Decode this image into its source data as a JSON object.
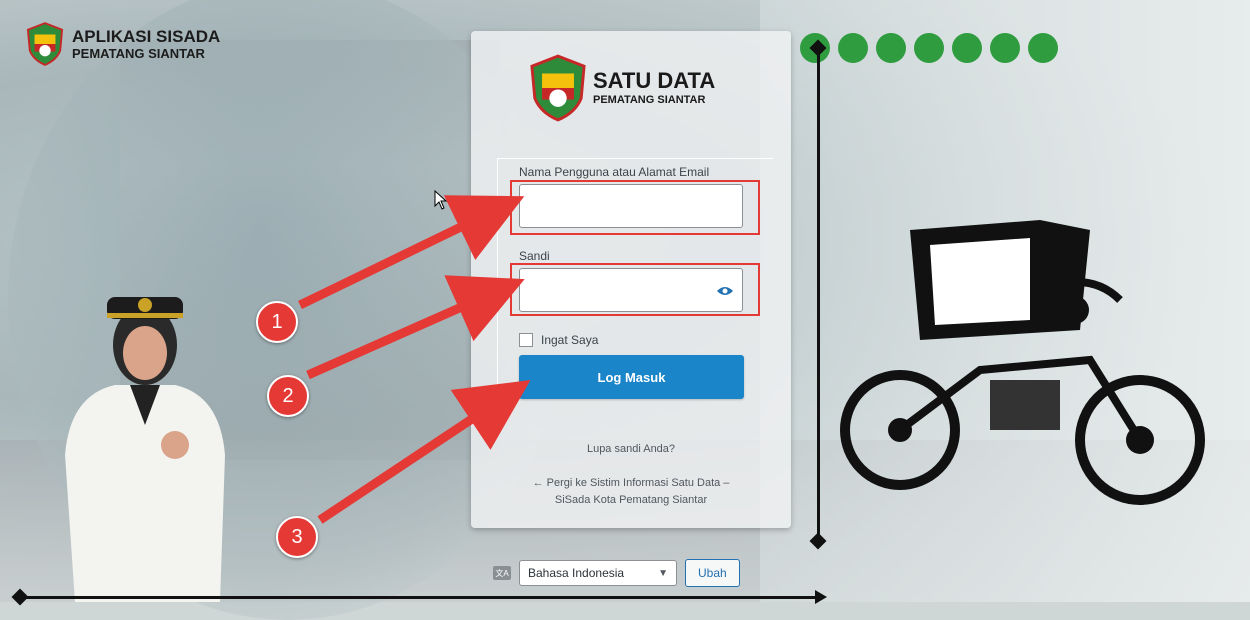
{
  "app": {
    "title_line1": "APLIKASI SISADA",
    "title_line2": "PEMATANG SIANTAR"
  },
  "brand": {
    "title": "SATU DATA",
    "subtitle": "PEMATANG SIANTAR"
  },
  "form": {
    "username_label": "Nama Pengguna atau Alamat Email",
    "username_value": "",
    "password_label": "Sandi",
    "password_value": "",
    "remember_label": "Ingat Saya",
    "login_button": "Log Masuk"
  },
  "links": {
    "lost_password": "Lupa sandi Anda?",
    "back_line1": "← Pergi ke Sistim Informasi Satu Data –",
    "back_line2": "SiSada Kota Pematang Siantar"
  },
  "language": {
    "selected": "Bahasa Indonesia",
    "submit": "Ubah"
  },
  "annotations": [
    "1",
    "2",
    "3"
  ],
  "colors": {
    "accent": "#1a85c9",
    "highlight": "#e53935",
    "dots": "#2e9c3f"
  },
  "icons": {
    "eye": "eye-icon",
    "language": "translate-icon",
    "dropdown": "chevron-down-icon"
  }
}
